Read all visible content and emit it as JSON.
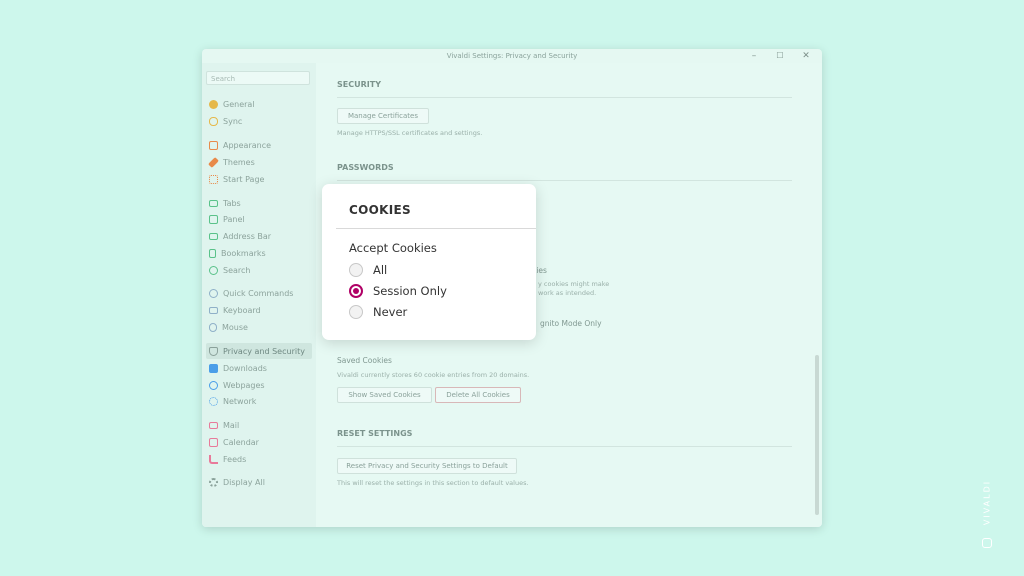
{
  "window": {
    "title": "Vivaldi Settings: Privacy and Security",
    "controls": {
      "minimize": "–",
      "maximize": "☐",
      "close": "✕"
    }
  },
  "sidebar": {
    "search_placeholder": "Search",
    "items": [
      {
        "label": "General",
        "icon": "general-icon",
        "color": "#e5b84a"
      },
      {
        "label": "Sync",
        "icon": "cloud-icon",
        "color": "#e5b84a"
      },
      {
        "label": "Appearance",
        "icon": "appearance-icon",
        "color": "#e88a4a"
      },
      {
        "label": "Themes",
        "icon": "brush-icon",
        "color": "#e88a4a"
      },
      {
        "label": "Start Page",
        "icon": "start-page-icon",
        "color": "#e88a4a"
      },
      {
        "label": "Tabs",
        "icon": "tabs-icon",
        "color": "#5ac28a"
      },
      {
        "label": "Panel",
        "icon": "panel-icon",
        "color": "#5ac28a"
      },
      {
        "label": "Address Bar",
        "icon": "address-bar-icon",
        "color": "#5ac28a"
      },
      {
        "label": "Bookmarks",
        "icon": "bookmark-icon",
        "color": "#5ac28a"
      },
      {
        "label": "Search",
        "icon": "search-icon",
        "color": "#5ac28a"
      },
      {
        "label": "Quick Commands",
        "icon": "quick-commands-icon",
        "color": "#8fb0c8"
      },
      {
        "label": "Keyboard",
        "icon": "keyboard-icon",
        "color": "#8fb0c8"
      },
      {
        "label": "Mouse",
        "icon": "mouse-icon",
        "color": "#8fb0c8"
      },
      {
        "label": "Privacy and Security",
        "icon": "shield-icon",
        "color": "#8aa19a",
        "active": true
      },
      {
        "label": "Downloads",
        "icon": "download-icon",
        "color": "#4a9ee8"
      },
      {
        "label": "Webpages",
        "icon": "globe-icon",
        "color": "#4a9ee8"
      },
      {
        "label": "Network",
        "icon": "network-icon",
        "color": "#4a9ee8"
      },
      {
        "label": "Mail",
        "icon": "mail-icon",
        "color": "#e87a9a"
      },
      {
        "label": "Calendar",
        "icon": "calendar-icon",
        "color": "#e87a9a"
      },
      {
        "label": "Feeds",
        "icon": "feeds-icon",
        "color": "#e87a9a"
      },
      {
        "label": "Display All",
        "icon": "gear-icon",
        "color": "#8aa19a"
      }
    ]
  },
  "content": {
    "security": {
      "title": "SECURITY",
      "button": "Manage Certificates",
      "description": "Manage HTTPS/SSL certificates and settings."
    },
    "passwords": {
      "title": "PASSWORDS"
    },
    "partial": {
      "cookies_tail": "kies",
      "note_line1": "y cookies might make",
      "note_line2": "work as intended.",
      "incognito_tail": "gnito Mode Only"
    },
    "saved_cookies": {
      "label": "Saved Cookies",
      "description": "Vivaldi currently stores 60 cookie entries from 20 domains.",
      "show_button": "Show Saved Cookies",
      "delete_button": "Delete All Cookies"
    },
    "reset": {
      "title": "RESET SETTINGS",
      "button": "Reset Privacy and Security Settings to Default",
      "description": "This will reset the settings in this section to default values."
    }
  },
  "popup": {
    "title": "COOKIES",
    "subtitle": "Accept Cookies",
    "options": [
      {
        "label": "All",
        "selected": false
      },
      {
        "label": "Session Only",
        "selected": true
      },
      {
        "label": "Never",
        "selected": false
      }
    ],
    "accent_color": "#b00066"
  },
  "brand": {
    "text": "VIVALDI",
    "icon": "vivaldi-logo-icon"
  }
}
